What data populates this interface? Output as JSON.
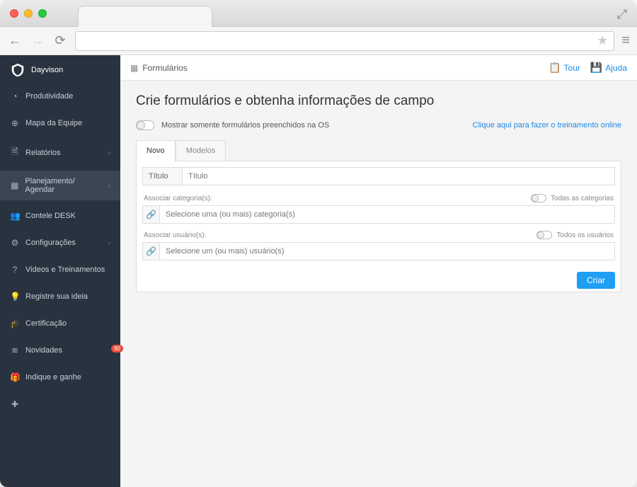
{
  "user": {
    "name": "Dayvison"
  },
  "sidebar": {
    "items": [
      {
        "icon": "gauge",
        "label": "Produtividade"
      },
      {
        "icon": "globe",
        "label": "Mapa da Equipe"
      },
      {
        "icon": "file",
        "label": "Relatórios",
        "chev": true
      },
      {
        "icon": "grid",
        "label": "Planejamento/ Agendar",
        "chev": true,
        "active": true
      },
      {
        "icon": "users",
        "label": "Contele DESK"
      },
      {
        "icon": "gear",
        "label": "Configurações",
        "chev": true
      },
      {
        "icon": "help",
        "label": "Videos e Treinamentos"
      },
      {
        "icon": "bulb",
        "label": "Registre sua ideia"
      },
      {
        "icon": "grad",
        "label": "Certificação"
      },
      {
        "icon": "rss",
        "label": "Novidades",
        "badge": "90"
      },
      {
        "icon": "gift",
        "label": "Indique e ganhe"
      },
      {
        "icon": "plus",
        "label": ""
      }
    ]
  },
  "pagebar": {
    "title": "Formulários",
    "tour": "Tour",
    "help": "Ajuda"
  },
  "content": {
    "heading": "Crie formulários e obtenha informações de campo",
    "toggle_label": "Mostrar somente formulários preenchidos na OS",
    "training_link": "Clique aqui para fazer o treinamento online",
    "tabs": {
      "novo": "Novo",
      "modelos": "Modelos"
    },
    "field_title_label": "Título",
    "field_title_placeholder": "Título",
    "assoc_cat_label": "Associar categoria(s):",
    "assoc_cat_all": "Todas as categorias",
    "assoc_cat_placeholder": "Selecione uma (ou mais) categoria(s)",
    "assoc_user_label": "Associar usuário(s):",
    "assoc_user_all": "Todos os usuários",
    "assoc_user_placeholder": "Selecione um (ou mais) usuário(s)",
    "create_button": "Criar"
  }
}
